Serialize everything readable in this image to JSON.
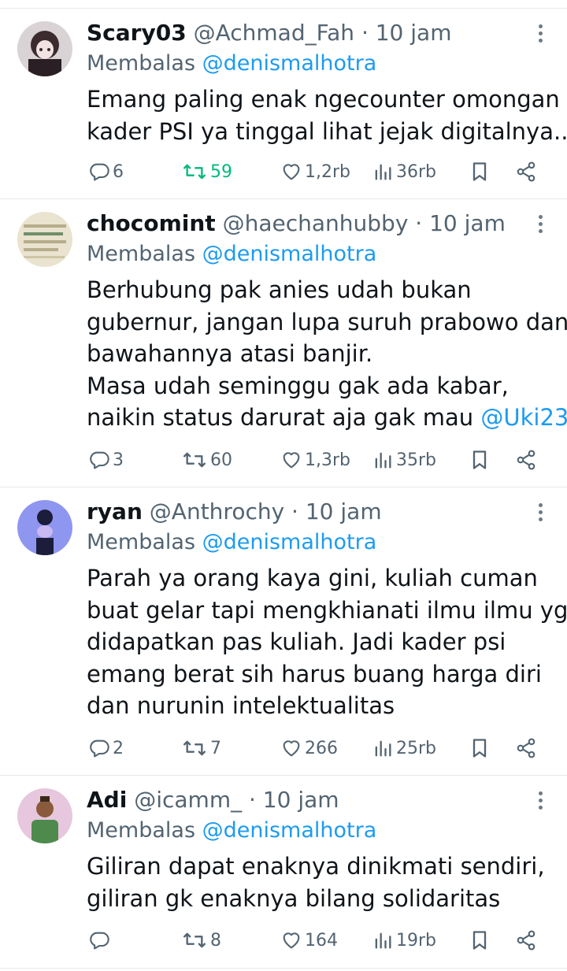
{
  "reply_prefix": "Membalas",
  "tweets": [
    {
      "name": "Scary03",
      "handle": "@Achmad_Fah · 10 jam",
      "reply_to": "@denismalhotra",
      "lines": [
        "Emang paling enak ngecounter omongan",
        "kader PSI ya tinggal lihat jejak digitalnya.."
      ],
      "replies": "6",
      "retweets": "59",
      "likes": "1,2rb",
      "views": "36rb",
      "retweeted": true
    },
    {
      "name": "chocomint",
      "handle": "@haechanhubby · 10 jam",
      "reply_to": "@denismalhotra",
      "lines": [
        "Berhubung pak anies udah bukan",
        "gubernur, jangan lupa suruh prabowo dan",
        "bawahannya atasi banjir.",
        "Masa udah seminggu gak ada kabar,",
        "naikin status darurat aja gak mau "
      ],
      "last_line_link": "@Uki23",
      "replies": "3",
      "retweets": "60",
      "likes": "1,3rb",
      "views": "35rb",
      "retweeted": false
    },
    {
      "name": "ryan",
      "handle": "@Anthrochy · 10 jam",
      "reply_to": "@denismalhotra",
      "lines": [
        "Parah ya orang kaya gini, kuliah cuman",
        "buat gelar tapi mengkhianati ilmu ilmu yg",
        "didapatkan pas kuliah. Jadi kader psi",
        "emang berat sih harus buang harga diri",
        "dan nurunin intelektualitas"
      ],
      "replies": "2",
      "retweets": "7",
      "likes": "266",
      "views": "25rb",
      "retweeted": false
    },
    {
      "name": "Adi",
      "handle": "@icamm_ · 10 jam",
      "reply_to": "@denismalhotra",
      "lines": [
        "Giliran dapat enaknya dinikmati sendiri,",
        "giliran gk enaknya bilang solidaritas"
      ],
      "replies": "",
      "retweets": "8",
      "likes": "164",
      "views": "19rb",
      "retweeted": false
    }
  ],
  "icons": {
    "reply": "reply-icon",
    "retweet": "retweet-icon",
    "like": "heart-icon",
    "views": "views-icon",
    "bookmark": "bookmark-icon",
    "share": "share-icon",
    "more": "more-vertical-icon"
  },
  "colors": {
    "link": "#1d9bf0",
    "retweet_active": "#00ba7c",
    "secondary": "#536471",
    "text": "#0f1419",
    "divider": "#e6e9ec"
  }
}
